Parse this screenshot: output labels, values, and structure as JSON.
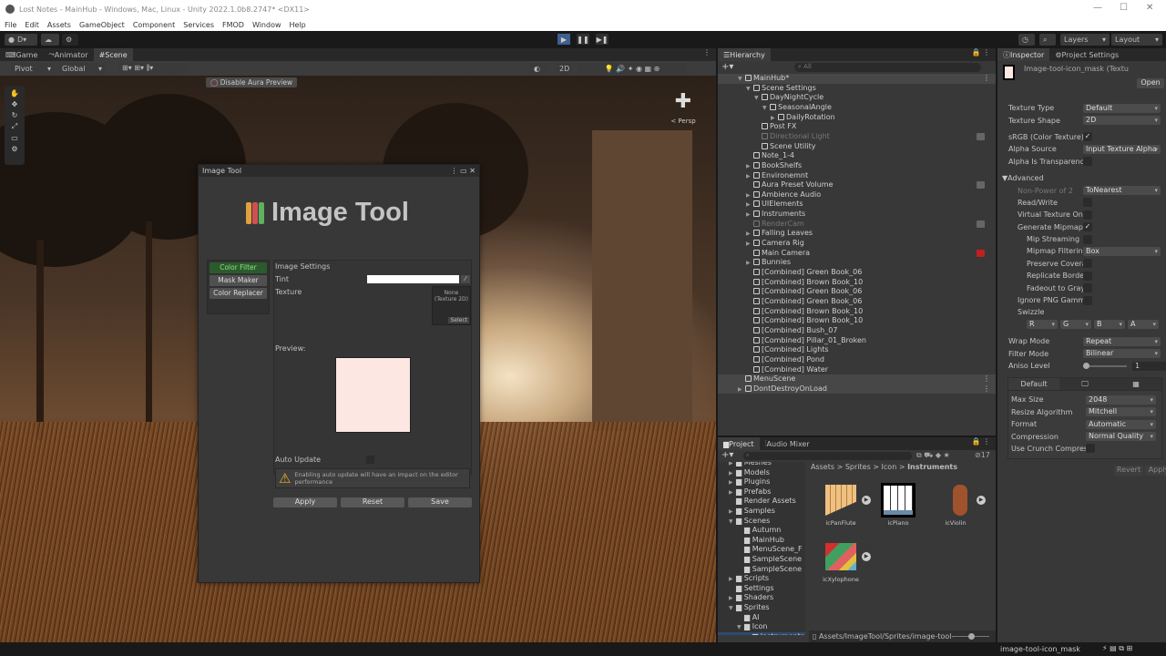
{
  "window": {
    "title": "Lost Notes - MainHub - Windows, Mac, Linux - Unity 2022.1.0b8.2747* <DX11>",
    "minimize": "—",
    "maximize": "☐",
    "close": "✕"
  },
  "menu": [
    "File",
    "Edit",
    "Assets",
    "GameObject",
    "Component",
    "Services",
    "FMOD",
    "Window",
    "Help"
  ],
  "toolbar": {
    "account": "D",
    "layers": "Layers",
    "layout": "Layout"
  },
  "scene": {
    "tabs": [
      "Game",
      "Animator",
      "Scene"
    ],
    "pivot": "Pivot",
    "global": "Global",
    "mode2d": "2D",
    "aura_button": "Disable Aura Preview",
    "persp": "< Persp"
  },
  "image_tool": {
    "window_title": "Image Tool",
    "title": "Image Tool",
    "tabs": [
      "Color Filter",
      "Mask Maker",
      "Color Replacer"
    ],
    "settings_header": "Image Settings",
    "tint_label": "Tint",
    "texture_label": "Texture",
    "texture_value": "None (Texture 2D)",
    "select": "Select",
    "preview_label": "Preview:",
    "preview_color": "#fde7e2",
    "auto_update_label": "Auto Update",
    "warning": "Enabling auto update will have an impact on the editor performance",
    "buttons": [
      "Apply",
      "Reset",
      "Save"
    ]
  },
  "hierarchy": {
    "tab": "Hierarchy",
    "search_placeholder": "All",
    "items": [
      {
        "name": "MainHub*",
        "depth": 0,
        "exp": "open",
        "scene": true
      },
      {
        "name": "Scene Settings",
        "depth": 1,
        "exp": "open"
      },
      {
        "name": "DayNightCycle",
        "depth": 2,
        "exp": "open"
      },
      {
        "name": "SeasonalAngle",
        "depth": 3,
        "exp": "open"
      },
      {
        "name": "DailyRotation",
        "depth": 4,
        "exp": "closed"
      },
      {
        "name": "Post FX",
        "depth": 2
      },
      {
        "name": "Directional Light",
        "depth": 2,
        "dim": true,
        "badge": true
      },
      {
        "name": "Scene Utility",
        "depth": 2
      },
      {
        "name": "Note_1-4",
        "depth": 1
      },
      {
        "name": "BookShelfs",
        "depth": 1,
        "exp": "closed"
      },
      {
        "name": "Environemnt",
        "depth": 1,
        "exp": "closed"
      },
      {
        "name": "Aura Preset Volume",
        "depth": 1,
        "badge": true
      },
      {
        "name": "Ambience Audio",
        "depth": 1,
        "exp": "closed"
      },
      {
        "name": "UIElements",
        "depth": 1,
        "exp": "closed"
      },
      {
        "name": "Instruments",
        "depth": 1,
        "exp": "closed"
      },
      {
        "name": "RenderCam",
        "depth": 1,
        "dim": true,
        "badge": true
      },
      {
        "name": "Falling Leaves",
        "depth": 1,
        "exp": "closed"
      },
      {
        "name": "Camera Rig",
        "depth": 1,
        "exp": "closed"
      },
      {
        "name": "Main Camera",
        "depth": 1,
        "badge_red": true
      },
      {
        "name": "Bunnies",
        "depth": 1,
        "exp": "closed"
      },
      {
        "name": "[Combined] Green Book_06",
        "depth": 1
      },
      {
        "name": "[Combined] Brown Book_10",
        "depth": 1
      },
      {
        "name": "[Combined] Green Book_06",
        "depth": 1
      },
      {
        "name": "[Combined] Green Book_06",
        "depth": 1
      },
      {
        "name": "[Combined] Brown Book_10",
        "depth": 1
      },
      {
        "name": "[Combined] Brown Book_10",
        "depth": 1
      },
      {
        "name": "[Combined] Bush_07",
        "depth": 1
      },
      {
        "name": "[Combined] Pillar_01_Broken",
        "depth": 1
      },
      {
        "name": "[Combined] Lights",
        "depth": 1
      },
      {
        "name": "[Combined] Pond",
        "depth": 1
      },
      {
        "name": "[Combined] Water",
        "depth": 1
      },
      {
        "name": "MenuScene",
        "depth": 0,
        "scene": true
      },
      {
        "name": "DontDestroyOnLoad",
        "depth": 0,
        "exp": "closed",
        "scene": true
      }
    ]
  },
  "project": {
    "tabs": [
      "Project",
      "Audio Mixer"
    ],
    "hidden_count": "17",
    "breadcrumb": [
      "Assets",
      "Sprites",
      "Icon",
      "Instruments"
    ],
    "tree": [
      {
        "name": "Meshes",
        "depth": 0,
        "exp": "closed"
      },
      {
        "name": "Models",
        "depth": 0,
        "exp": "closed"
      },
      {
        "name": "Plugins",
        "depth": 0,
        "exp": "closed"
      },
      {
        "name": "Prefabs",
        "depth": 0,
        "exp": "closed"
      },
      {
        "name": "Render Assets",
        "depth": 0
      },
      {
        "name": "Samples",
        "depth": 0,
        "exp": "closed"
      },
      {
        "name": "Scenes",
        "depth": 0,
        "exp": "open"
      },
      {
        "name": "Autumn",
        "depth": 1
      },
      {
        "name": "MainHub",
        "depth": 1
      },
      {
        "name": "MenuScene_F",
        "depth": 1
      },
      {
        "name": "SampleScene",
        "depth": 1
      },
      {
        "name": "SampleScene",
        "depth": 1
      },
      {
        "name": "Scripts",
        "depth": 0,
        "exp": "closed"
      },
      {
        "name": "Settings",
        "depth": 0
      },
      {
        "name": "Shaders",
        "depth": 0,
        "exp": "closed"
      },
      {
        "name": "Sprites",
        "depth": 0,
        "exp": "open"
      },
      {
        "name": "AI",
        "depth": 1
      },
      {
        "name": "Icon",
        "depth": 1,
        "exp": "open"
      },
      {
        "name": "Instruments",
        "depth": 2,
        "selected": true
      }
    ],
    "assets": [
      {
        "name": "icPanFlute",
        "icon": "pan-flute"
      },
      {
        "name": "icPiano",
        "icon": "piano"
      },
      {
        "name": "icViolin",
        "icon": "violin"
      },
      {
        "name": "icXylophone",
        "icon": "xylophone"
      }
    ],
    "path": "Assets/ImageTool/Sprites/image-tool-"
  },
  "inspector": {
    "tabs": [
      "Inspector",
      "Project Settings"
    ],
    "asset_title": "Image-tool-icon_mask (Textu",
    "open": "Open",
    "sections": [
      [
        {
          "k": "Texture Type",
          "t": "dd",
          "v": "Default"
        },
        {
          "k": "Texture Shape",
          "t": "dd",
          "v": "2D"
        }
      ],
      [
        {
          "k": "sRGB (Color Texture)",
          "t": "cb",
          "v": "✓"
        },
        {
          "k": "Alpha Source",
          "t": "dd",
          "v": "Input Texture Alpha"
        },
        {
          "k": "Alpha Is Transparenc",
          "t": "cb",
          "v": ""
        }
      ],
      [
        {
          "k": "Advanced",
          "t": "hdr"
        },
        {
          "k": "Non-Power of 2",
          "t": "dd",
          "v": "ToNearest",
          "i": 1,
          "dim": true
        },
        {
          "k": "Read/Write",
          "t": "cb",
          "v": "",
          "i": 1
        },
        {
          "k": "Virtual Texture Onl",
          "t": "cb",
          "v": "",
          "i": 1
        },
        {
          "k": "Generate Mipmaps",
          "t": "cb",
          "v": "✓",
          "i": 1
        },
        {
          "k": "Mip Streaming",
          "t": "cb",
          "v": "",
          "i": 2
        },
        {
          "k": "Mipmap Filtering",
          "t": "dd",
          "v": "Box",
          "i": 2
        },
        {
          "k": "Preserve Coverage",
          "t": "cb",
          "v": "",
          "i": 2
        },
        {
          "k": "Replicate Border",
          "t": "cb",
          "v": "",
          "i": 2
        },
        {
          "k": "Fadeout to Gray",
          "t": "cb",
          "v": "",
          "i": 2
        },
        {
          "k": "Ignore PNG Gamma",
          "t": "cb",
          "v": "",
          "i": 1
        },
        {
          "k": "Swizzle",
          "t": "lbl",
          "i": 1
        },
        {
          "k": "",
          "t": "swz",
          "v": [
            "R",
            "G",
            "B",
            "A"
          ]
        }
      ],
      [
        {
          "k": "Wrap Mode",
          "t": "dd",
          "v": "Repeat"
        },
        {
          "k": "Filter Mode",
          "t": "dd",
          "v": "Bilinear"
        },
        {
          "k": "Aniso Level",
          "t": "slider",
          "v": "1"
        }
      ]
    ],
    "platform": {
      "tab": "Default",
      "rows": [
        {
          "k": "Max Size",
          "t": "dd",
          "v": "2048"
        },
        {
          "k": "Resize Algorithm",
          "t": "dd",
          "v": "Mitchell"
        },
        {
          "k": "Format",
          "t": "dd",
          "v": "Automatic"
        },
        {
          "k": "Compression",
          "t": "dd",
          "v": "Normal Quality"
        },
        {
          "k": "Use Crunch Compres",
          "t": "cb",
          "v": ""
        }
      ]
    },
    "revert": "Revert",
    "apply": "Apply"
  },
  "status": {
    "asset_label": "image-tool-icon_mask"
  }
}
